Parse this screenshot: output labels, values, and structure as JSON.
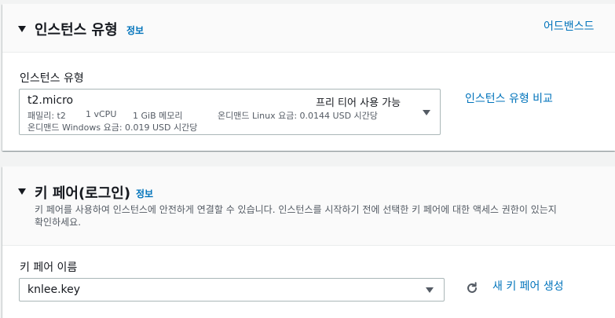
{
  "instance_type_section": {
    "title": "인스턴스 유형",
    "info": "정보",
    "advanced_link": "어드밴스드",
    "field_label": "인스턴스 유형",
    "selected": {
      "name": "t2.micro",
      "tag": "프리 티어 사용 가능",
      "family": "패밀리: t2",
      "vcpu": "1 vCPU",
      "memory": "1 GiB 메모리",
      "linux_price": "온디맨드 Linux 요금: 0.0144 USD 시간당",
      "windows_price": "온디맨드 Windows 요금: 0.019 USD 시간당"
    },
    "compare_link": "인스턴스 유형 비교"
  },
  "key_pair_section": {
    "title": "키 페어(로그인)",
    "info": "정보",
    "description_line1": "키 페어를 사용하여 인스턴스에 안전하게 연결할 수 있습니다. 인스턴스를 시작하기 전에 선택한 키 페어에 대한 액세스 권한이 있는지",
    "description_line2": "확인하세요.",
    "field_label": "키 페어 이름",
    "selected_value": "knlee.key",
    "refresh_icon": "refresh-icon",
    "create_link": "새 키 페어 생성"
  },
  "colors": {
    "link": "#0073bb",
    "text": "#16191f",
    "muted": "#545b64",
    "border": "#aab7b8",
    "background": "#f2f3f3"
  }
}
